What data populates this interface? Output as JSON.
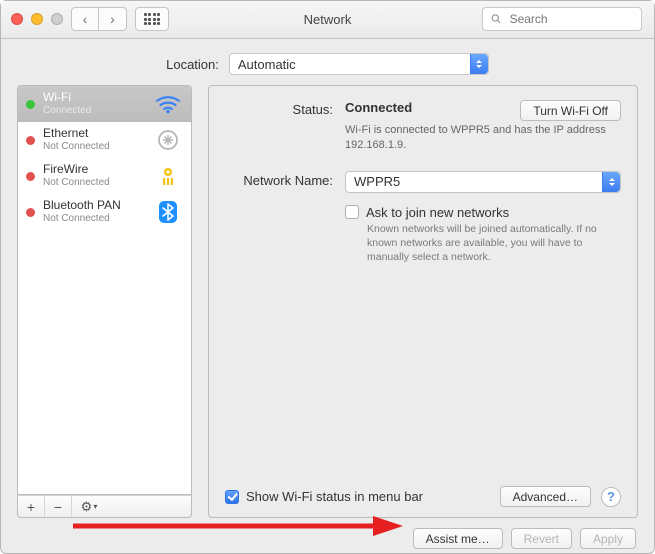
{
  "window": {
    "title": "Network"
  },
  "search": {
    "placeholder": "Search"
  },
  "location": {
    "label": "Location:",
    "value": "Automatic"
  },
  "sidebar": {
    "items": [
      {
        "name": "Wi-Fi",
        "status_text": "Connected",
        "status_color": "green",
        "icon": "wifi",
        "selected": true
      },
      {
        "name": "Ethernet",
        "status_text": "Not Connected",
        "status_color": "red",
        "icon": "ethernet",
        "selected": false
      },
      {
        "name": "FireWire",
        "status_text": "Not Connected",
        "status_color": "red",
        "icon": "firewire",
        "selected": false
      },
      {
        "name": "Bluetooth PAN",
        "status_text": "Not Connected",
        "status_color": "red",
        "icon": "bluetooth",
        "selected": false
      }
    ]
  },
  "detail": {
    "status_label": "Status:",
    "status_value": "Connected",
    "wifi_toggle_label": "Turn Wi-Fi Off",
    "status_description": "Wi-Fi is connected to WPPR5 and has the IP address 192.168.1.9.",
    "network_name_label": "Network Name:",
    "network_name_value": "WPPR5",
    "ask_join_label": "Ask to join new networks",
    "ask_join_checked": false,
    "ask_join_description": "Known networks will be joined automatically. If no known networks are available, you will have to manually select a network.",
    "show_menubar_label": "Show Wi-Fi status in menu bar",
    "show_menubar_checked": true,
    "advanced_label": "Advanced…"
  },
  "footer": {
    "assist_label": "Assist me…",
    "revert_label": "Revert",
    "apply_label": "Apply"
  },
  "annotation": {
    "arrow_color": "#e62020"
  }
}
